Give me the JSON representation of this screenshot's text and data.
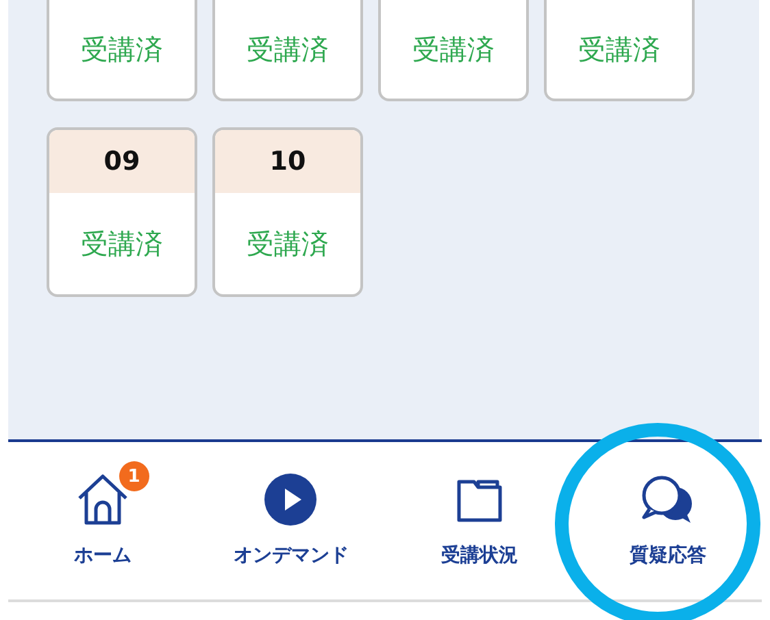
{
  "lessons": [
    {
      "status": "受講済"
    },
    {
      "status": "受講済"
    },
    {
      "status": "受講済"
    },
    {
      "status": "受講済"
    },
    {
      "number": "09",
      "status": "受講済"
    },
    {
      "number": "10",
      "status": "受講済"
    }
  ],
  "bottom_nav": [
    {
      "kind": "home",
      "label": "ホーム",
      "badge": "1"
    },
    {
      "kind": "play",
      "label": "オンデマンド"
    },
    {
      "kind": "folder",
      "label": "受講状況"
    },
    {
      "kind": "chat",
      "label": "質疑応答"
    }
  ]
}
